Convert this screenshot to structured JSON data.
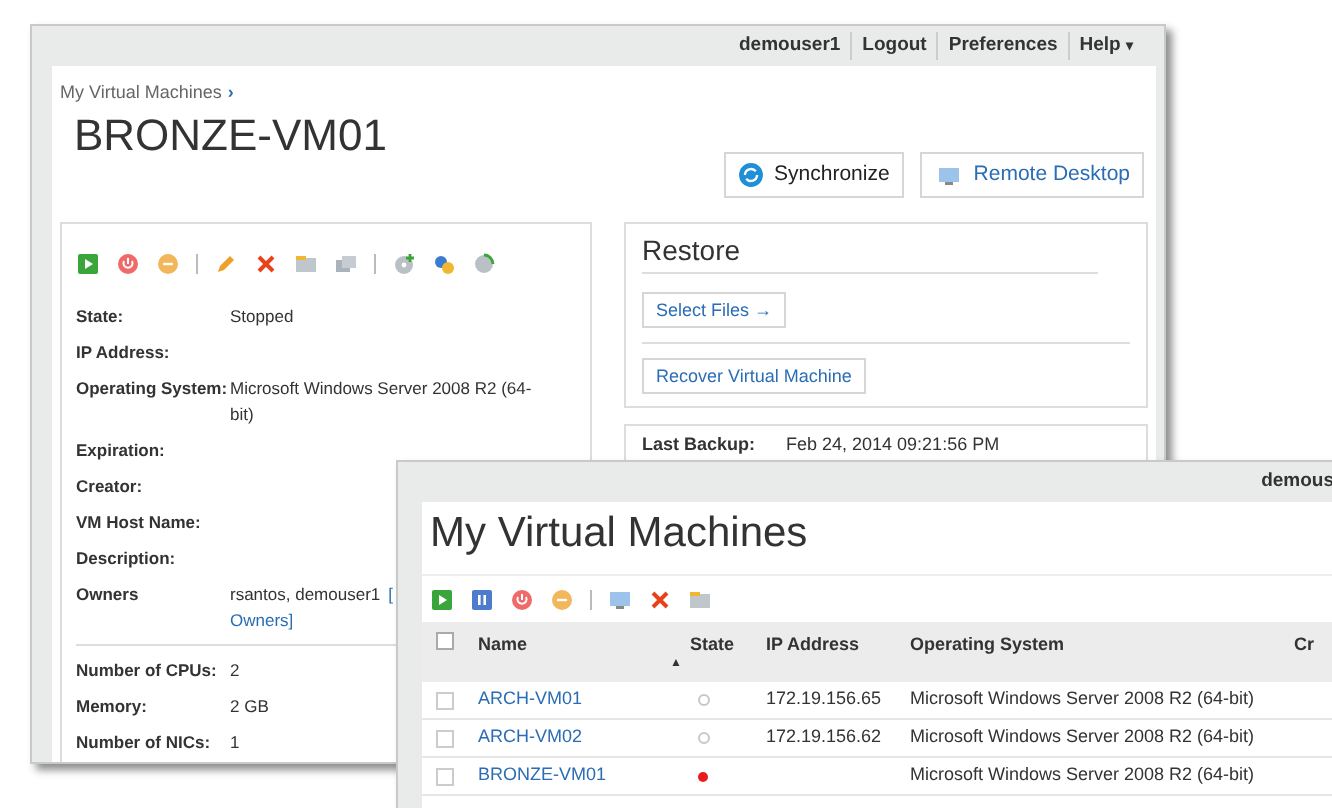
{
  "detail_window": {
    "user": "demouser1",
    "links": [
      "Logout",
      "Preferences",
      "Help"
    ],
    "help_caret": "▾",
    "breadcrumb": "My Virtual Machines",
    "breadcrumb_sep": "›",
    "title": "BRONZE-VM01",
    "buttons": [
      {
        "kind": "sync",
        "label": "Synchronize"
      },
      {
        "kind": "remote",
        "label": "Remote Desktop"
      }
    ],
    "fields": [
      {
        "label": "State:",
        "value": "Stopped"
      },
      {
        "label": "IP Address:"
      },
      {
        "label": "Operating System:",
        "value": "Microsoft Windows Server 2008 R2 (64-bit)"
      },
      {
        "label": "Expiration:"
      },
      {
        "label": "Creator:"
      },
      {
        "label": "VM Host Name:"
      },
      {
        "label": "Description:"
      },
      {
        "label": "Owners",
        "value": "rsantos, demouser1",
        "link": [
          "[",
          "Owners]"
        ]
      }
    ],
    "hardware": [
      {
        "label": "Number of CPUs:",
        "value": "2"
      },
      {
        "label": "Memory:",
        "value": "2 GB"
      },
      {
        "label": "Number of NICs:",
        "value": "1"
      }
    ],
    "restore": {
      "title": "Restore",
      "select_files": "Select Files",
      "arrow": "→",
      "recover": "Recover Virtual Machine"
    },
    "backup": {
      "label": "Last Backup:",
      "value": "Feb 24, 2014 09:21:56 PM"
    }
  },
  "list_window": {
    "user": "demous",
    "title": "My Virtual Machines",
    "all_checked": false,
    "columns": [
      "Name",
      "State",
      "IP Address",
      "Operating System",
      "Cr"
    ],
    "sort_mark": "▲",
    "rows": [
      {
        "name": "ARCH-VM01",
        "kind": "ring",
        "color": "#c8c8c8",
        "ip": "172.19.156.65",
        "os": "Microsoft Windows Server 2008 R2 (64-bit)",
        "checked": false
      },
      {
        "name": "ARCH-VM02",
        "kind": "ring",
        "color": "#c8c8c8",
        "ip": "172.19.156.62",
        "os": "Microsoft Windows Server 2008 R2 (64-bit)",
        "checked": false
      },
      {
        "name": "BRONZE-VM01",
        "kind": "dot",
        "color": "#e81c1c",
        "os": "Microsoft Windows Server 2008 R2 (64-bit)",
        "checked": false
      }
    ]
  }
}
